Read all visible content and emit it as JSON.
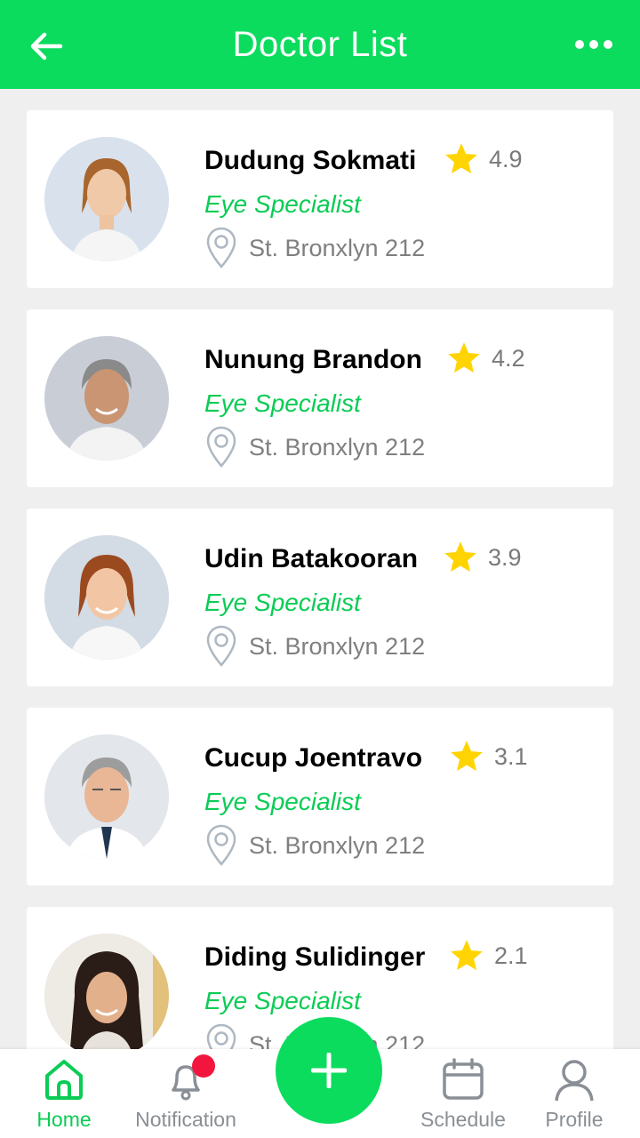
{
  "header": {
    "title": "Doctor List",
    "back_icon": "arrow-left-icon",
    "menu_icon": "more-horizontal-icon",
    "color": "#0bdc5e"
  },
  "doctors": [
    {
      "name": "Dudung Sokmati",
      "rating": "4.9",
      "specialty": "Eye Specialist",
      "address": "St. Bronxlyn 212"
    },
    {
      "name": "Nunung Brandon",
      "rating": "4.2",
      "specialty": "Eye Specialist",
      "address": "St. Bronxlyn 212"
    },
    {
      "name": "Udin Batakooran",
      "rating": "3.9",
      "specialty": "Eye Specialist",
      "address": "St. Bronxlyn 212"
    },
    {
      "name": "Cucup Joentravo",
      "rating": "3.1",
      "specialty": "Eye Specialist",
      "address": "St. Bronxlyn 212"
    },
    {
      "name": "Diding Sulidinger",
      "rating": "2.1",
      "specialty": "Eye Specialist",
      "address": "St. Bronxlyn 212"
    }
  ],
  "nav": {
    "home": "Home",
    "notification": "Notification",
    "schedule": "Schedule",
    "profile": "Profile",
    "fab_icon": "plus-icon"
  },
  "colors": {
    "accent": "#0bdc5e",
    "specialty": "#0bcc55",
    "star": "#ffd400",
    "badge": "#f2163e"
  }
}
